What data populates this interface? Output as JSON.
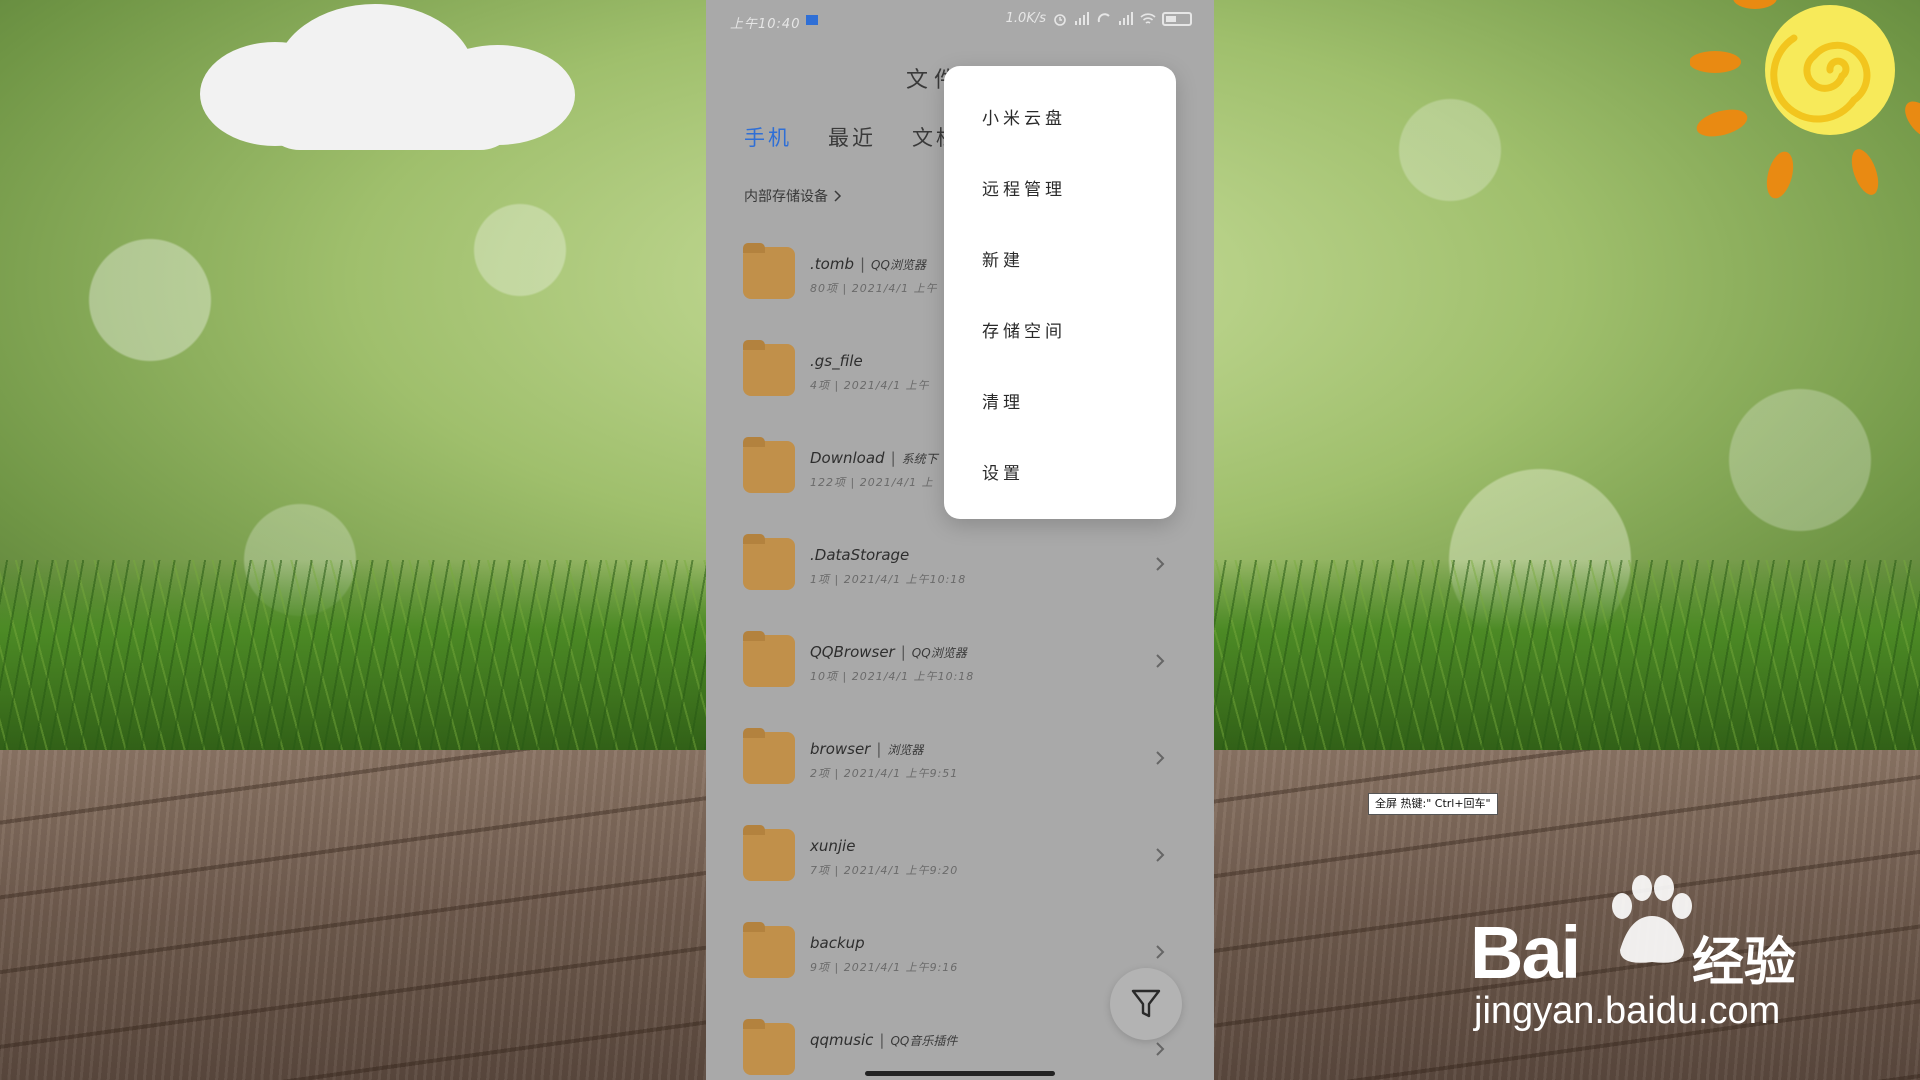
{
  "status_bar": {
    "time": "上午10:40",
    "speed": "1.0K/s"
  },
  "app": {
    "title": "文件",
    "tabs": [
      {
        "label": "手机",
        "active": true
      },
      {
        "label": "最近",
        "active": false
      },
      {
        "label": "文档",
        "active": false
      }
    ],
    "breadcrumb": "内部存储设备"
  },
  "files": [
    {
      "name": ".tomb",
      "tag": "QQ浏览器",
      "meta": "80项 | 2021/4/1 上午"
    },
    {
      "name": ".gs_file",
      "tag": "",
      "meta": "4项 | 2021/4/1 上午"
    },
    {
      "name": "Download",
      "tag": "系统下",
      "meta": "122项 | 2021/4/1 上"
    },
    {
      "name": ".DataStorage",
      "tag": "",
      "meta": "1项 | 2021/4/1 上午10:18"
    },
    {
      "name": "QQBrowser",
      "tag": "QQ浏览器",
      "meta": "10项 | 2021/4/1 上午10:18"
    },
    {
      "name": "browser",
      "tag": "浏览器",
      "meta": "2项 | 2021/4/1 上午9:51"
    },
    {
      "name": "xunjie",
      "tag": "",
      "meta": "7项 | 2021/4/1 上午9:20"
    },
    {
      "name": "backup",
      "tag": "",
      "meta": "9项 | 2021/4/1 上午9:16"
    },
    {
      "name": "qqmusic",
      "tag": "QQ音乐插件",
      "meta": ""
    }
  ],
  "menu": {
    "items": [
      "小米云盘",
      "远程管理",
      "新建",
      "存储空间",
      "清理",
      "设置"
    ]
  },
  "tooltip": "全屏 热键:\" Ctrl+回车\"",
  "watermark": {
    "brand": "Bai",
    "brand_cn": "经验",
    "url": "jingyan.baidu.com"
  },
  "colors": {
    "accent": "#2f6fd6",
    "folder": "#c1904a",
    "overlay_bg": "#a9a9a9"
  }
}
